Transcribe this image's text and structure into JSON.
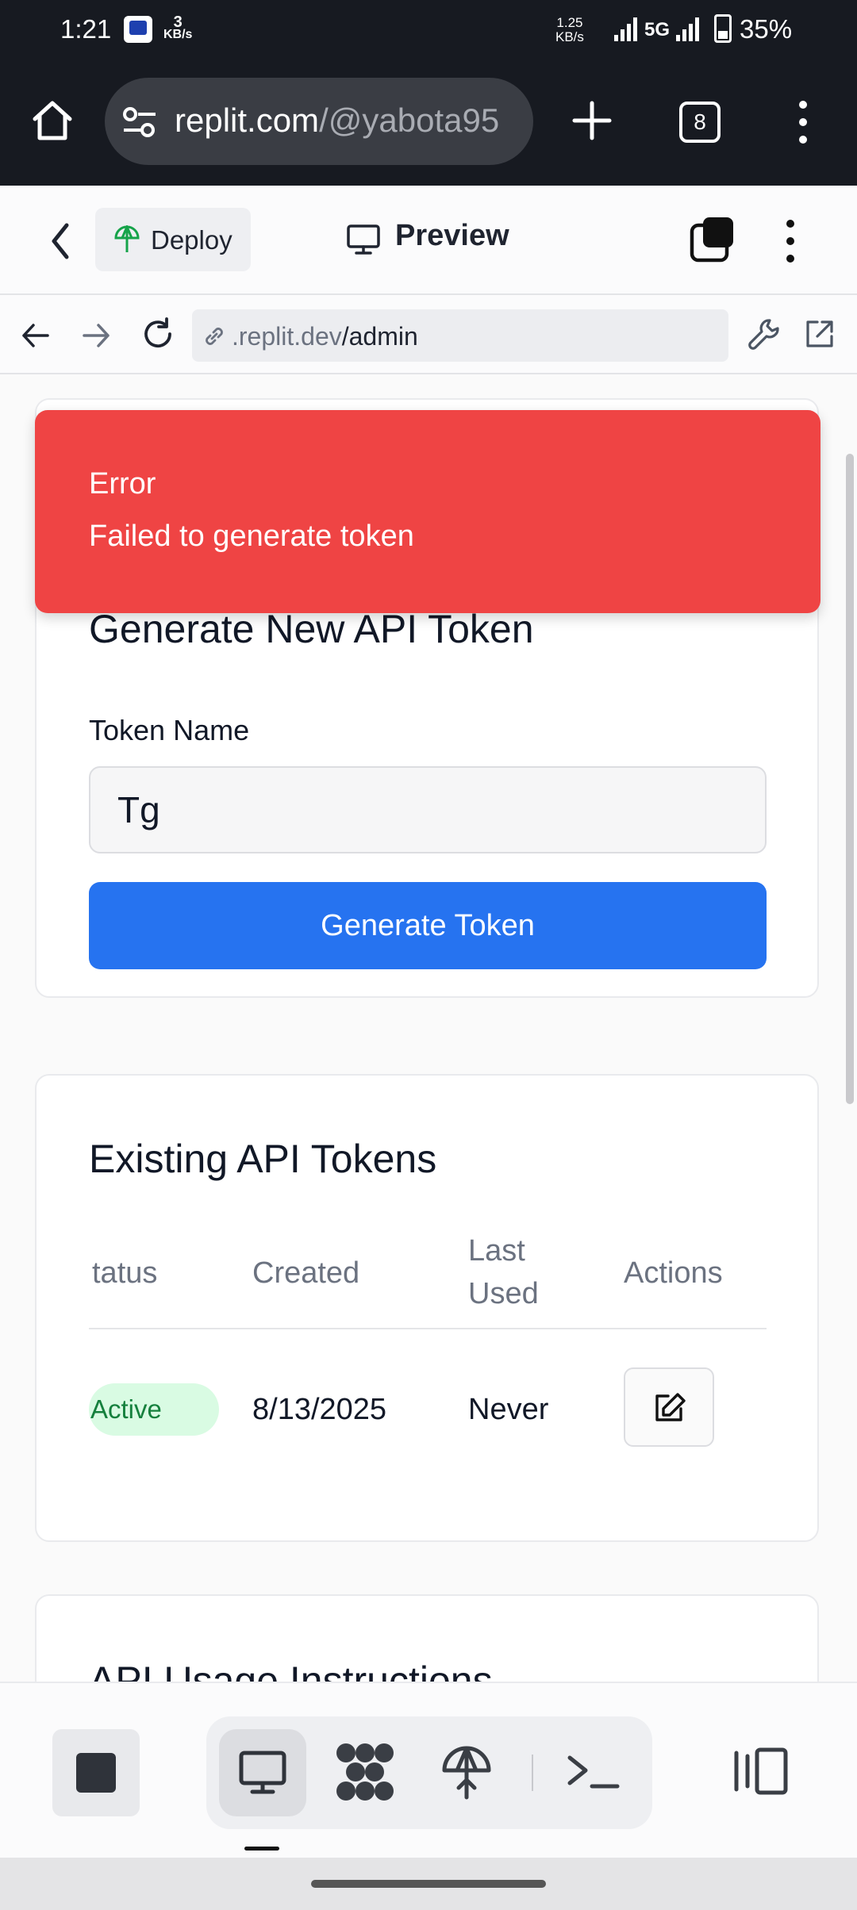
{
  "status_bar": {
    "time": "1:21",
    "net_speed_value": "3",
    "net_speed_unit": "KB/s",
    "right_speed_value": "1.25",
    "right_speed_unit": "KB/s",
    "network": "5G",
    "battery": "35%"
  },
  "browser": {
    "url_host": "replit.com",
    "url_path": "/@yabota95",
    "tab_count": "8"
  },
  "replit_header": {
    "deploy_label": "Deploy",
    "preview_label": "Preview"
  },
  "webview": {
    "url_host": ".replit.dev",
    "url_path": "/admin"
  },
  "toast": {
    "title": "Error",
    "description": "Failed to generate token",
    "color": "#ef4444"
  },
  "generate_card": {
    "title": "Generate New API Token",
    "field_label": "Token Name",
    "field_value": "Tg",
    "button_label": "Generate Token",
    "button_color": "#2673f0"
  },
  "tokens_card": {
    "title": "Existing API Tokens",
    "columns": {
      "status": "tatus",
      "created": "Created",
      "last_used_1": "Last",
      "last_used_2": "Used",
      "actions": "Actions"
    },
    "rows": [
      {
        "status": "Active",
        "created": "8/13/2025",
        "last_used": "Never"
      }
    ]
  },
  "usage_card": {
    "title": "API Usage Instructions"
  },
  "icons": [
    "home-icon",
    "tune-icon",
    "plus-icon",
    "tabs-icon",
    "more-vert-icon",
    "chevron-left-icon",
    "deploy-icon",
    "monitor-icon",
    "windows-icon",
    "arrow-left-icon",
    "arrow-right-icon",
    "reload-icon",
    "link-icon",
    "wrench-icon",
    "external-link-icon",
    "edit-icon",
    "stop-icon",
    "workflow-icon",
    "terminal-icon",
    "panel-icon"
  ]
}
